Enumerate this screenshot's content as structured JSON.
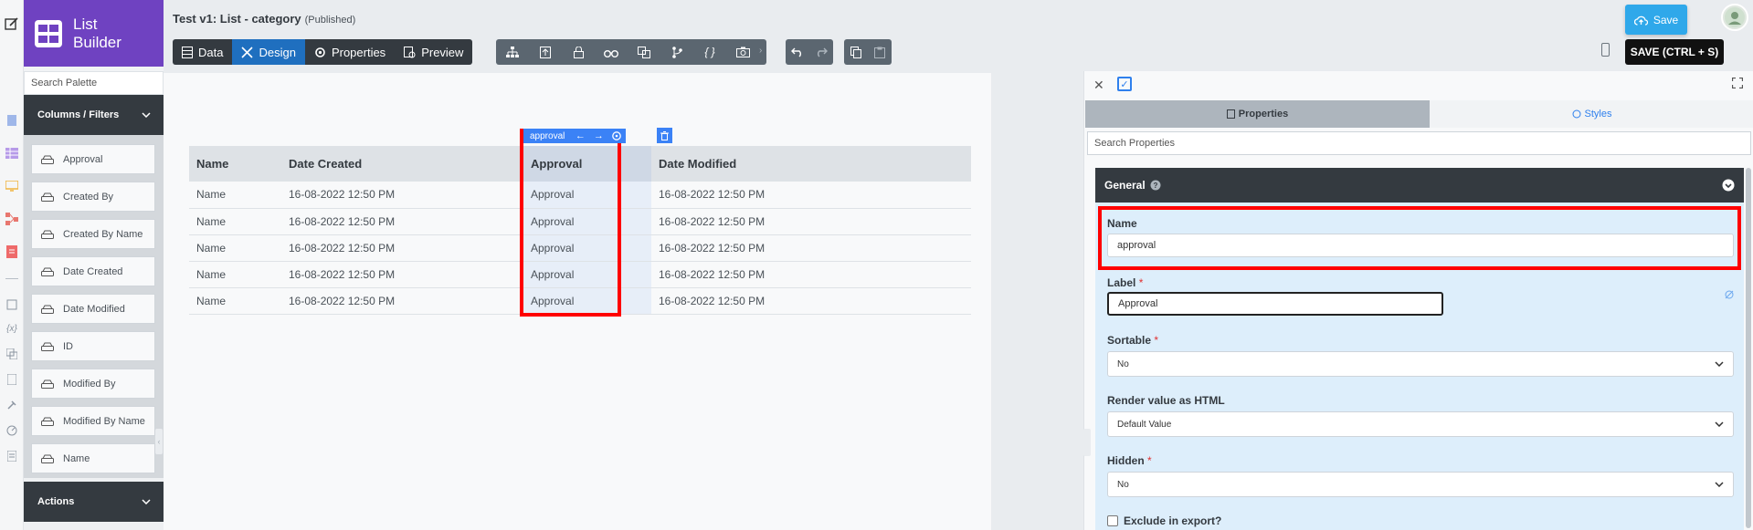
{
  "brand": {
    "line1": "List",
    "line2": "Builder"
  },
  "header": {
    "title": "Test v1: List - category",
    "status": "(Published)",
    "modes": [
      {
        "label": "Data",
        "active": false
      },
      {
        "label": "Design",
        "active": true
      },
      {
        "label": "Properties",
        "active": false
      },
      {
        "label": "Preview",
        "active": false
      }
    ],
    "tool_icons": [
      "hierarchy-icon",
      "upload-box-icon",
      "lock-icon",
      "binoculars-icon",
      "translate-icon",
      "branch-icon",
      "braces-icon",
      "camera-icon"
    ],
    "save_label": "Save",
    "save_shortcut_label": "SAVE (CTRL + S)"
  },
  "palette": {
    "search_placeholder": "Search Palette",
    "section_title": "Columns / Filters",
    "items": [
      "Approval",
      "Created By",
      "Created By Name",
      "Date Created",
      "Date Modified",
      "ID",
      "Modified By",
      "Modified By Name",
      "Name"
    ],
    "actions_title": "Actions"
  },
  "canvas": {
    "columns": [
      "Name",
      "Date Created",
      "Approval",
      "Date Modified"
    ],
    "rows": [
      [
        "Name",
        "16-08-2022 12:50 PM",
        "Approval",
        "16-08-2022 12:50 PM"
      ],
      [
        "Name",
        "16-08-2022 12:50 PM",
        "Approval",
        "16-08-2022 12:50 PM"
      ],
      [
        "Name",
        "16-08-2022 12:50 PM",
        "Approval",
        "16-08-2022 12:50 PM"
      ],
      [
        "Name",
        "16-08-2022 12:50 PM",
        "Approval",
        "16-08-2022 12:50 PM"
      ],
      [
        "Name",
        "16-08-2022 12:50 PM",
        "Approval",
        "16-08-2022 12:50 PM"
      ]
    ],
    "selected_column_tag": "approval"
  },
  "properties": {
    "tab_properties": "Properties",
    "tab_styles": "Styles",
    "search_placeholder": "Search Properties",
    "section_general": "General",
    "name_label": "Name",
    "name_value": "approval",
    "label_label": "Label",
    "label_value": "Approval",
    "sortable_label": "Sortable",
    "sortable_value": "No",
    "render_html_label": "Render value as HTML",
    "render_html_value": "Default Value",
    "hidden_label": "Hidden",
    "hidden_value": "No",
    "exclude_export_label": "Exclude in export?"
  },
  "colors": {
    "brand": "#6f42c1",
    "active_mode": "#1f6fbf",
    "highlight": "#ff0000",
    "save_blue": "#2fa8ea"
  }
}
